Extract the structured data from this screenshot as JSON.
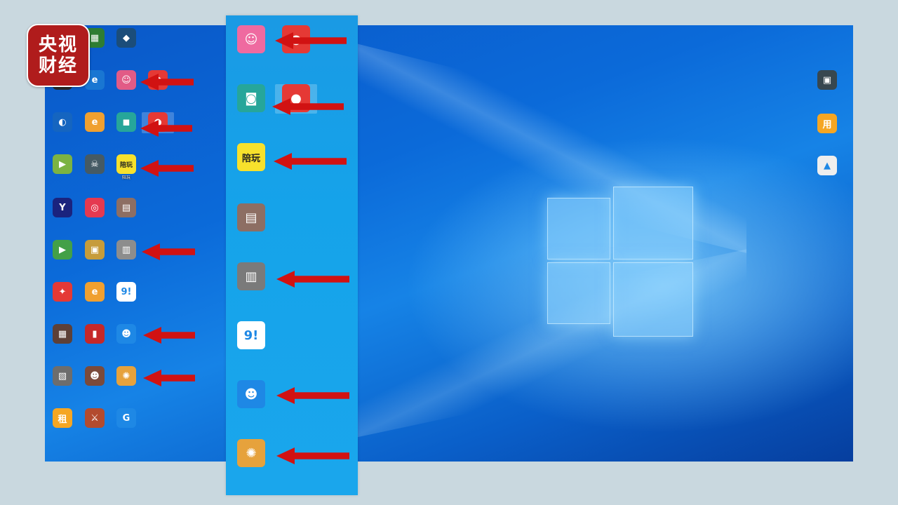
{
  "logo": {
    "line1": "央视",
    "line2": "财经"
  },
  "desktop_icons_left": [
    {
      "label": "",
      "glyph": "🎮",
      "bg": "#6b4a2b"
    },
    {
      "label": "",
      "glyph": "▦",
      "bg": "#2e7d32"
    },
    {
      "label": "",
      "glyph": "◆",
      "bg": "#1b4d7a"
    },
    {
      "label": "",
      "glyph": "◉",
      "bg": "#2a2a2a"
    },
    {
      "label": "",
      "glyph": "e",
      "bg": "#1976d2"
    },
    {
      "label": "",
      "glyph": "☺",
      "bg": "#e25b86"
    },
    {
      "label": "",
      "glyph": "●",
      "bg": "#e53935"
    },
    {
      "label": "",
      "glyph": "◐",
      "bg": "#1565c0"
    },
    {
      "label": "",
      "glyph": "e",
      "bg": "#f0a030"
    },
    {
      "label": "",
      "glyph": "◼",
      "bg": "#26a69a"
    },
    {
      "label": "",
      "glyph": "●",
      "bg": "#e53935"
    },
    {
      "label": "",
      "glyph": "▶",
      "bg": "#7cb342"
    },
    {
      "label": "",
      "glyph": "☠",
      "bg": "#455a64"
    },
    {
      "label": "陪玩",
      "glyph": "陪玩",
      "bg": "#f7e12c"
    },
    {
      "label": "",
      "glyph": "Y",
      "bg": "#1a237e"
    },
    {
      "label": "",
      "glyph": "◎",
      "bg": "#e53950"
    },
    {
      "label": "",
      "glyph": "▤",
      "bg": "#8d6e63"
    },
    {
      "label": "",
      "glyph": "▶",
      "bg": "#43a047"
    },
    {
      "label": "",
      "glyph": "▣",
      "bg": "#c69c3b"
    },
    {
      "label": "",
      "glyph": "▥",
      "bg": "#8d8d8d"
    },
    {
      "label": "",
      "glyph": "✦",
      "bg": "#e53935"
    },
    {
      "label": "",
      "glyph": "e",
      "bg": "#f0a030"
    },
    {
      "label": "",
      "glyph": "9!",
      "bg": "#ffffff"
    },
    {
      "label": "",
      "glyph": "▦",
      "bg": "#5d4037"
    },
    {
      "label": "",
      "glyph": "▮",
      "bg": "#c62828"
    },
    {
      "label": "",
      "glyph": "☻",
      "bg": "#1e88e5"
    },
    {
      "label": "",
      "glyph": "▧",
      "bg": "#6d6d6d"
    },
    {
      "label": "",
      "glyph": "☻",
      "bg": "#7b4a3a"
    },
    {
      "label": "",
      "glyph": "✺",
      "bg": "#e6a23c"
    },
    {
      "label": "",
      "glyph": "租",
      "bg": "#f5a623"
    },
    {
      "label": "",
      "glyph": "⚔",
      "bg": "#b34b2e"
    },
    {
      "label": "",
      "glyph": "G",
      "bg": "#1e88e5"
    }
  ],
  "zoom_icons": [
    {
      "label": "",
      "glyph": "☺",
      "bg": "#ef6aa0"
    },
    {
      "label": "",
      "glyph": "●",
      "bg": "#e53935"
    },
    {
      "label": "",
      "glyph": "◙",
      "bg": "#26a69a"
    },
    {
      "label": "",
      "glyph": "●",
      "bg": "#e53935"
    },
    {
      "label": "",
      "glyph": "陪玩",
      "bg": "#f7e12c"
    },
    {
      "label": "",
      "glyph": "▤",
      "bg": "#8d6e63"
    },
    {
      "label": "",
      "glyph": "▥",
      "bg": "#7a7a7a"
    },
    {
      "label": "",
      "glyph": "9!",
      "bg": "#ffffff"
    },
    {
      "label": "",
      "glyph": "☻",
      "bg": "#1e88e5"
    },
    {
      "label": "",
      "glyph": "✺",
      "bg": "#e6a23c"
    }
  ],
  "right_icons": [
    {
      "label": "",
      "glyph": "▣",
      "bg": "#37474f"
    },
    {
      "label": "",
      "glyph": "用",
      "bg": "#f5a623"
    },
    {
      "label": "",
      "glyph": "▲",
      "bg": "#eeeeee"
    }
  ],
  "colors": {
    "arrow": "#d11212",
    "desktop": "#0b6ad9",
    "strip": "#1aa6ec",
    "badge": "#b01c1c"
  }
}
